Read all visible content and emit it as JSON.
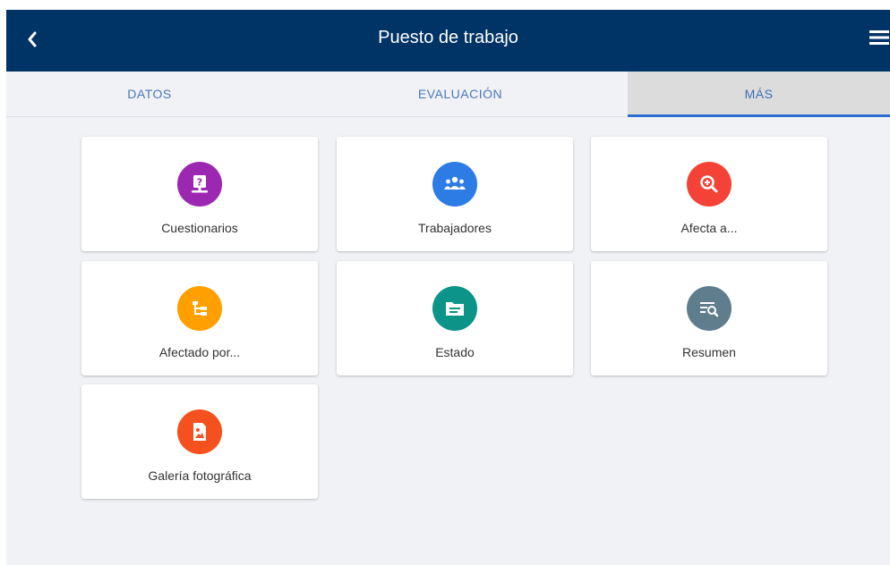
{
  "header": {
    "title": "Puesto de trabajo",
    "background": "#003366",
    "back_icon": "chevron-left-icon",
    "menu_icon": "hamburger-menu-icon"
  },
  "tabs": [
    {
      "label": "DATOS",
      "active": false
    },
    {
      "label": "EVALUACIÓN",
      "active": false
    },
    {
      "label": "MÁS",
      "active": true
    }
  ],
  "cards": [
    {
      "label": "Cuestionarios",
      "icon": "questionnaire-icon",
      "color": "#9c27b0"
    },
    {
      "label": "Trabajadores",
      "icon": "people-group-icon",
      "color": "#2d7be5"
    },
    {
      "label": "Afecta a...",
      "icon": "zoom-in-icon",
      "color": "#f44336"
    },
    {
      "label": "Afectado por...",
      "icon": "tree-structure-icon",
      "color": "#ff9f00"
    },
    {
      "label": "Estado",
      "icon": "folder-icon",
      "color": "#0d9488"
    },
    {
      "label": "Resumen",
      "icon": "list-search-icon",
      "color": "#5f7d8c"
    },
    {
      "label": "Galería fotográfica",
      "icon": "image-file-icon",
      "color": "#f4511e"
    }
  ]
}
